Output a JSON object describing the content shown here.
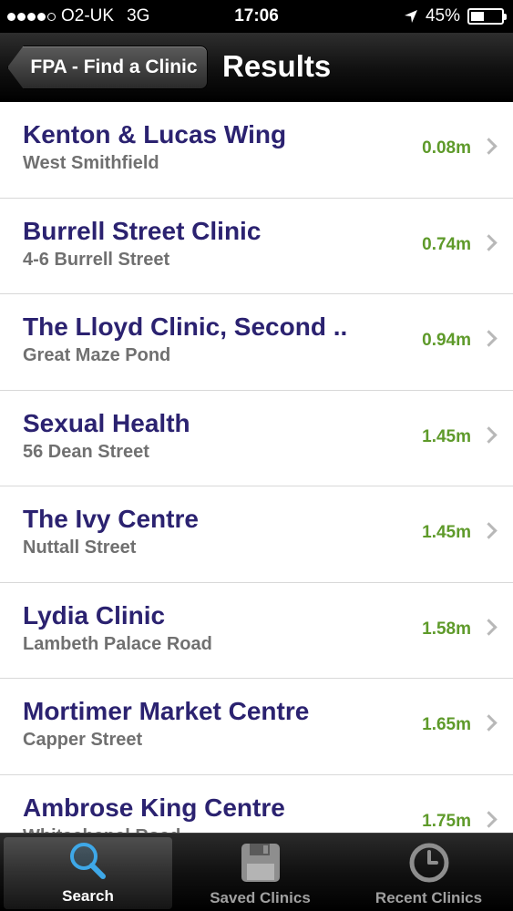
{
  "status_bar": {
    "carrier": "O2-UK",
    "network": "3G",
    "time": "17:06",
    "battery_percent": "45%",
    "battery_level": 0.45,
    "signal_bars_filled": 4,
    "signal_bars_total": 5
  },
  "nav": {
    "back_label": "FPA - Find a Clinic",
    "title": "Results"
  },
  "results": [
    {
      "name": "Kenton & Lucas Wing",
      "address": "West Smithfield",
      "distance": "0.08m"
    },
    {
      "name": "Burrell Street Clinic",
      "address": "4-6 Burrell Street",
      "distance": "0.74m"
    },
    {
      "name": "The Lloyd Clinic, Second ..",
      "address": "Great Maze Pond",
      "distance": "0.94m"
    },
    {
      "name": "Sexual Health",
      "address": "56 Dean Street",
      "distance": "1.45m"
    },
    {
      "name": "The Ivy Centre",
      "address": "Nuttall Street",
      "distance": "1.45m"
    },
    {
      "name": "Lydia Clinic",
      "address": "Lambeth Palace Road",
      "distance": "1.58m"
    },
    {
      "name": "Mortimer Market Centre",
      "address": "Capper Street",
      "distance": "1.65m"
    },
    {
      "name": "Ambrose King Centre",
      "address": "Whitechapel Road",
      "distance": "1.75m"
    }
  ],
  "tabs": [
    {
      "label": "Search",
      "icon": "magnifier-icon",
      "active": true
    },
    {
      "label": "Saved Clinics",
      "icon": "floppy-disk-icon",
      "active": false
    },
    {
      "label": "Recent Clinics",
      "icon": "clock-icon",
      "active": false
    }
  ],
  "colors": {
    "clinic_name": "#2b2270",
    "address": "#707070",
    "distance": "#5e9a2a"
  }
}
